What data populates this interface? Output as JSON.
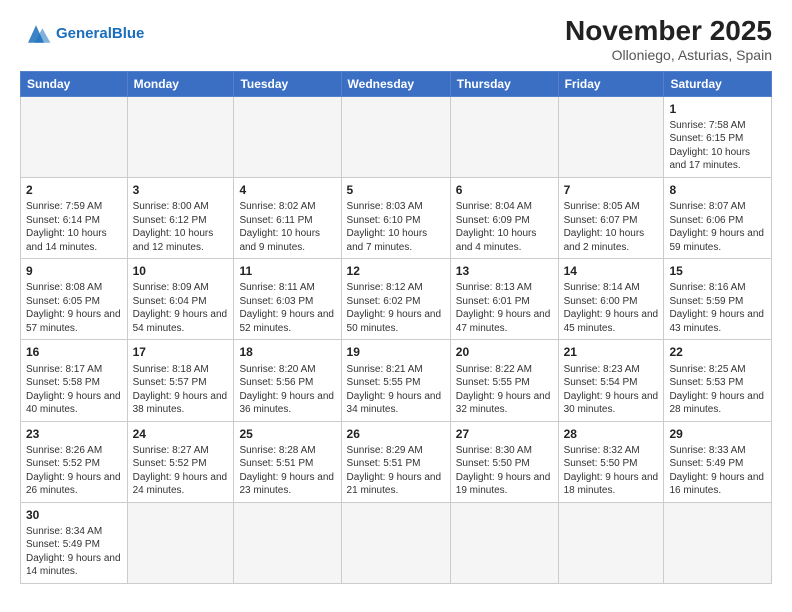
{
  "header": {
    "logo_text_normal": "General",
    "logo_text_blue": "Blue",
    "title": "November 2025",
    "subtitle": "Olloniego, Asturias, Spain"
  },
  "weekdays": [
    "Sunday",
    "Monday",
    "Tuesday",
    "Wednesday",
    "Thursday",
    "Friday",
    "Saturday"
  ],
  "weeks": [
    [
      {
        "day": "",
        "info": ""
      },
      {
        "day": "",
        "info": ""
      },
      {
        "day": "",
        "info": ""
      },
      {
        "day": "",
        "info": ""
      },
      {
        "day": "",
        "info": ""
      },
      {
        "day": "",
        "info": ""
      },
      {
        "day": "1",
        "info": "Sunrise: 7:58 AM\nSunset: 6:15 PM\nDaylight: 10 hours and 17 minutes."
      }
    ],
    [
      {
        "day": "2",
        "info": "Sunrise: 7:59 AM\nSunset: 6:14 PM\nDaylight: 10 hours and 14 minutes."
      },
      {
        "day": "3",
        "info": "Sunrise: 8:00 AM\nSunset: 6:12 PM\nDaylight: 10 hours and 12 minutes."
      },
      {
        "day": "4",
        "info": "Sunrise: 8:02 AM\nSunset: 6:11 PM\nDaylight: 10 hours and 9 minutes."
      },
      {
        "day": "5",
        "info": "Sunrise: 8:03 AM\nSunset: 6:10 PM\nDaylight: 10 hours and 7 minutes."
      },
      {
        "day": "6",
        "info": "Sunrise: 8:04 AM\nSunset: 6:09 PM\nDaylight: 10 hours and 4 minutes."
      },
      {
        "day": "7",
        "info": "Sunrise: 8:05 AM\nSunset: 6:07 PM\nDaylight: 10 hours and 2 minutes."
      },
      {
        "day": "8",
        "info": "Sunrise: 8:07 AM\nSunset: 6:06 PM\nDaylight: 9 hours and 59 minutes."
      }
    ],
    [
      {
        "day": "9",
        "info": "Sunrise: 8:08 AM\nSunset: 6:05 PM\nDaylight: 9 hours and 57 minutes."
      },
      {
        "day": "10",
        "info": "Sunrise: 8:09 AM\nSunset: 6:04 PM\nDaylight: 9 hours and 54 minutes."
      },
      {
        "day": "11",
        "info": "Sunrise: 8:11 AM\nSunset: 6:03 PM\nDaylight: 9 hours and 52 minutes."
      },
      {
        "day": "12",
        "info": "Sunrise: 8:12 AM\nSunset: 6:02 PM\nDaylight: 9 hours and 50 minutes."
      },
      {
        "day": "13",
        "info": "Sunrise: 8:13 AM\nSunset: 6:01 PM\nDaylight: 9 hours and 47 minutes."
      },
      {
        "day": "14",
        "info": "Sunrise: 8:14 AM\nSunset: 6:00 PM\nDaylight: 9 hours and 45 minutes."
      },
      {
        "day": "15",
        "info": "Sunrise: 8:16 AM\nSunset: 5:59 PM\nDaylight: 9 hours and 43 minutes."
      }
    ],
    [
      {
        "day": "16",
        "info": "Sunrise: 8:17 AM\nSunset: 5:58 PM\nDaylight: 9 hours and 40 minutes."
      },
      {
        "day": "17",
        "info": "Sunrise: 8:18 AM\nSunset: 5:57 PM\nDaylight: 9 hours and 38 minutes."
      },
      {
        "day": "18",
        "info": "Sunrise: 8:20 AM\nSunset: 5:56 PM\nDaylight: 9 hours and 36 minutes."
      },
      {
        "day": "19",
        "info": "Sunrise: 8:21 AM\nSunset: 5:55 PM\nDaylight: 9 hours and 34 minutes."
      },
      {
        "day": "20",
        "info": "Sunrise: 8:22 AM\nSunset: 5:55 PM\nDaylight: 9 hours and 32 minutes."
      },
      {
        "day": "21",
        "info": "Sunrise: 8:23 AM\nSunset: 5:54 PM\nDaylight: 9 hours and 30 minutes."
      },
      {
        "day": "22",
        "info": "Sunrise: 8:25 AM\nSunset: 5:53 PM\nDaylight: 9 hours and 28 minutes."
      }
    ],
    [
      {
        "day": "23",
        "info": "Sunrise: 8:26 AM\nSunset: 5:52 PM\nDaylight: 9 hours and 26 minutes."
      },
      {
        "day": "24",
        "info": "Sunrise: 8:27 AM\nSunset: 5:52 PM\nDaylight: 9 hours and 24 minutes."
      },
      {
        "day": "25",
        "info": "Sunrise: 8:28 AM\nSunset: 5:51 PM\nDaylight: 9 hours and 23 minutes."
      },
      {
        "day": "26",
        "info": "Sunrise: 8:29 AM\nSunset: 5:51 PM\nDaylight: 9 hours and 21 minutes."
      },
      {
        "day": "27",
        "info": "Sunrise: 8:30 AM\nSunset: 5:50 PM\nDaylight: 9 hours and 19 minutes."
      },
      {
        "day": "28",
        "info": "Sunrise: 8:32 AM\nSunset: 5:50 PM\nDaylight: 9 hours and 18 minutes."
      },
      {
        "day": "29",
        "info": "Sunrise: 8:33 AM\nSunset: 5:49 PM\nDaylight: 9 hours and 16 minutes."
      }
    ],
    [
      {
        "day": "30",
        "info": "Sunrise: 8:34 AM\nSunset: 5:49 PM\nDaylight: 9 hours and 14 minutes."
      },
      {
        "day": "",
        "info": ""
      },
      {
        "day": "",
        "info": ""
      },
      {
        "day": "",
        "info": ""
      },
      {
        "day": "",
        "info": ""
      },
      {
        "day": "",
        "info": ""
      },
      {
        "day": "",
        "info": ""
      }
    ]
  ]
}
